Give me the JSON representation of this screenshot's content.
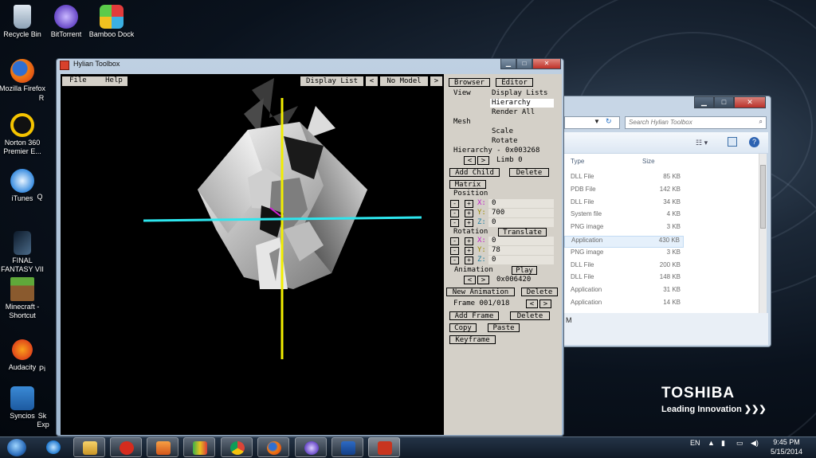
{
  "desktop": {
    "icons": [
      {
        "label": "Recycle Bin",
        "icon": "recycle-bin-icon"
      },
      {
        "label": "BitTorrent",
        "icon": "bittorrent-icon"
      },
      {
        "label": "Bamboo Dock",
        "icon": "bamboo-dock-icon"
      },
      {
        "label": "Mozilla Firefox",
        "icon": "firefox-icon"
      },
      {
        "label": "Norton 360 Premier E...",
        "icon": "norton-icon"
      },
      {
        "label": "iTunes",
        "icon": "itunes-icon"
      },
      {
        "label": "FINAL FANTASY VII",
        "icon": "final-fantasy-icon"
      },
      {
        "label": "Minecraft - Shortcut",
        "icon": "minecraft-icon"
      },
      {
        "label": "Audacity",
        "icon": "audacity-icon"
      },
      {
        "label": "Syncios",
        "icon": "syncios-icon"
      }
    ],
    "partial_labels": [
      "R",
      "Q",
      "Pi",
      "Sk",
      "Exp"
    ],
    "brand": {
      "name": "TOSHIBA",
      "tagline": "Leading Innovation ❯❯❯"
    }
  },
  "explorer": {
    "search_placeholder": "Search Hylian Toolbox",
    "columns": {
      "type": "Type",
      "size": "Size"
    },
    "rows": [
      {
        "type": "DLL File",
        "size": "85 KB"
      },
      {
        "type": "PDB File",
        "size": "142 KB"
      },
      {
        "type": "DLL File",
        "size": "34 KB"
      },
      {
        "type": "System file",
        "size": "4 KB"
      },
      {
        "type": "PNG image",
        "size": "3 KB"
      },
      {
        "type": "Application",
        "size": "430 KB"
      },
      {
        "type": "PNG image",
        "size": "3 KB"
      },
      {
        "type": "DLL File",
        "size": "200 KB"
      },
      {
        "type": "DLL File",
        "size": "148 KB"
      },
      {
        "type": "Application",
        "size": "31 KB"
      },
      {
        "type": "Application",
        "size": "14 KB"
      }
    ],
    "status_fragment": "M"
  },
  "app": {
    "title": "Hylian Toolbox",
    "menu": {
      "file": "File",
      "help": "Help"
    },
    "toolbar": {
      "display_list": "Display List",
      "prev": "<",
      "model": "No Model",
      "next": ">"
    },
    "tabs": {
      "browser": "Browser",
      "editor": "Editor"
    },
    "view_label": "View",
    "view_options": {
      "display_lists": "Display Lists",
      "hierarchy": "Hierarchy",
      "render_all": "Render All"
    },
    "mesh_label": "Mesh",
    "mesh_options": {
      "scale": "Scale",
      "rotate": "Rotate"
    },
    "hierarchy": "Hierarchy - 0x003268",
    "limb": "Limb 0",
    "add_child": "Add Child",
    "delete": "Delete",
    "matrix": "Matrix",
    "position_label": "Position",
    "position": {
      "x": "0",
      "y": "700",
      "z": "0"
    },
    "rotation_label": "Rotation",
    "translate": "Translate",
    "rotation": {
      "x": "0",
      "y": "78",
      "z": "0"
    },
    "animation_label": "Animation",
    "play": "Play",
    "animation_offset": "0x006420",
    "new_animation": "New Animation",
    "frame": "Frame 001/018",
    "add_frame": "Add Frame",
    "copy": "Copy",
    "paste": "Paste",
    "keyframe": "Keyframe",
    "minus": "-",
    "plus": "+",
    "lt": "<",
    "gt": ">",
    "axis": {
      "x": "X:",
      "y": "Y:",
      "z": "Z:"
    },
    "colors": {
      "y_axis": "#f2ee00",
      "x_axis": "#2de6ee",
      "z_axis": "#d21ed8"
    }
  },
  "taskbar": {
    "language": "EN",
    "time": "9:45 PM",
    "date": "5/15/2014"
  }
}
